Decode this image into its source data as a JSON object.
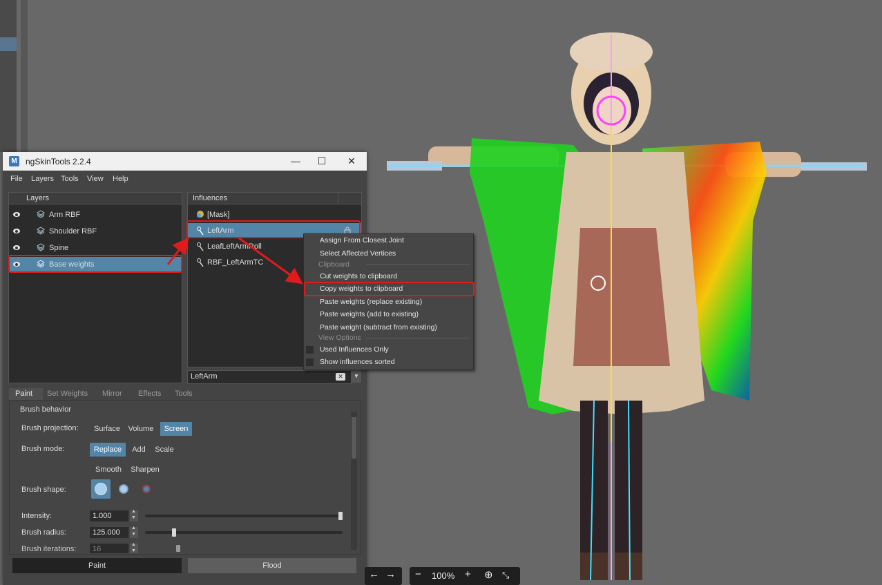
{
  "window": {
    "title": "ngSkinTools 2.2.4"
  },
  "menu": [
    "File",
    "Layers",
    "Tools",
    "View",
    "Help"
  ],
  "layers": {
    "header": "Layers",
    "items": [
      {
        "label": "Arm RBF",
        "visible": true,
        "selected": false
      },
      {
        "label": "Shoulder RBF",
        "visible": true,
        "selected": false
      },
      {
        "label": "Spine",
        "visible": true,
        "selected": false
      },
      {
        "label": "Base weights",
        "visible": true,
        "selected": true
      }
    ]
  },
  "influences": {
    "header": "Influences",
    "items": [
      {
        "label": "[Mask]",
        "icon": "mask-icon"
      },
      {
        "label": "LeftArm",
        "icon": "joint-icon",
        "selected": true
      },
      {
        "label": "LeafLeftArmRoll",
        "icon": "joint-icon"
      },
      {
        "label": "RBF_LeftArmTC",
        "icon": "joint-icon"
      }
    ],
    "filter_value": "LeftArm"
  },
  "context_menu": {
    "items": [
      "Assign From Closest Joint",
      "Select Affected Vertices",
      "Cut weights to clipboard",
      "Copy weights to clipboard",
      "Paste weights (replace existing)",
      "Paste weights (add to existing)",
      "Paste weight (subtract from existing)",
      "Used Influences Only",
      "Show influences sorted"
    ],
    "headers": [
      "Clipboard",
      "View Options"
    ],
    "highlighted": "Copy weights to clipboard"
  },
  "tabs": [
    "Paint",
    "Set Weights",
    "Mirror",
    "Effects",
    "Tools"
  ],
  "active_tab": "Paint",
  "paint": {
    "section": "Brush behavior",
    "projection_label": "Brush projection:",
    "projection_options": [
      "Surface",
      "Volume",
      "Screen"
    ],
    "projection_selected": "Screen",
    "mode_label": "Brush mode:",
    "mode_options": [
      "Replace",
      "Add",
      "Scale",
      "Smooth",
      "Sharpen"
    ],
    "mode_selected": "Replace",
    "shape_label": "Brush shape:",
    "intensity_label": "Intensity:",
    "intensity": "1.000",
    "intensity_level": 1.0,
    "radius_label": "Brush radius:",
    "radius": "125.000",
    "radius_level": 0.14,
    "iterations_label": "Brush iterations:",
    "iterations": "16",
    "iterations_level": 0.16,
    "paint_button": "Paint",
    "flood_button": "Flood"
  },
  "viewport_toolbar": {
    "zoom": "100%"
  },
  "colors": {
    "accent": "#5285a6",
    "highlight": "#e01b1b"
  }
}
